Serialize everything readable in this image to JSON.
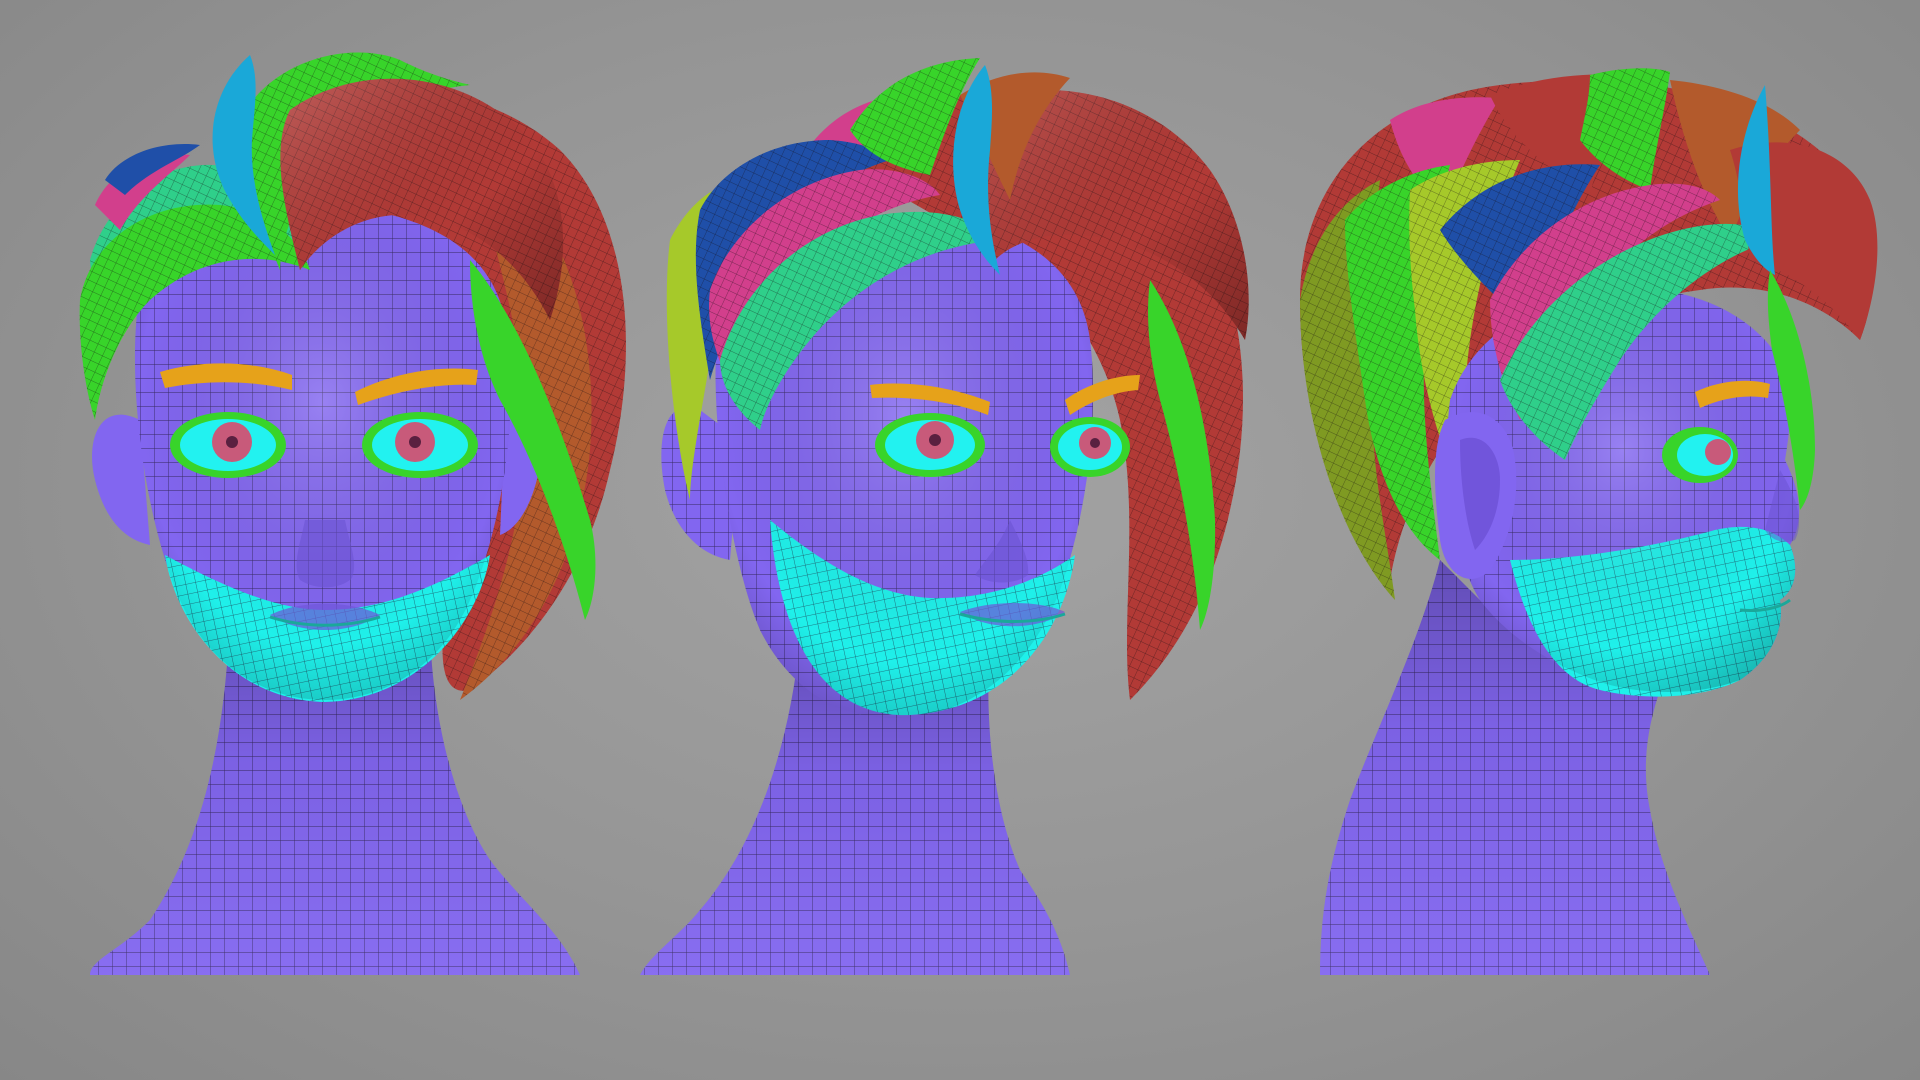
{
  "scene": {
    "background_color": "#949494",
    "view_count": 3,
    "view_labels": [
      "front",
      "three-quarter",
      "side"
    ]
  },
  "colors": {
    "skin": "#8266f0",
    "skin_dark": "#5f44c6",
    "lower_face": "#1ff0ea",
    "lower_face_dark": "#12b8b4",
    "eyebrow": "#e6a21a",
    "eye_white": "#22f2f0",
    "iris": "#c85a7a",
    "lip_line": "#1aa89a",
    "mesh_line": "#1c1430",
    "hair_red": "#b23a36",
    "hair_orange": "#b35a2c",
    "hair_green": "#38d42a",
    "hair_teal": "#2fcf8a",
    "hair_blue": "#1f4fa8",
    "hair_pink": "#d23f8c",
    "hair_olive": "#7f9a22",
    "hair_cyan_strand": "#1aa8d8",
    "hair_yellow_green": "#a6c92a"
  }
}
